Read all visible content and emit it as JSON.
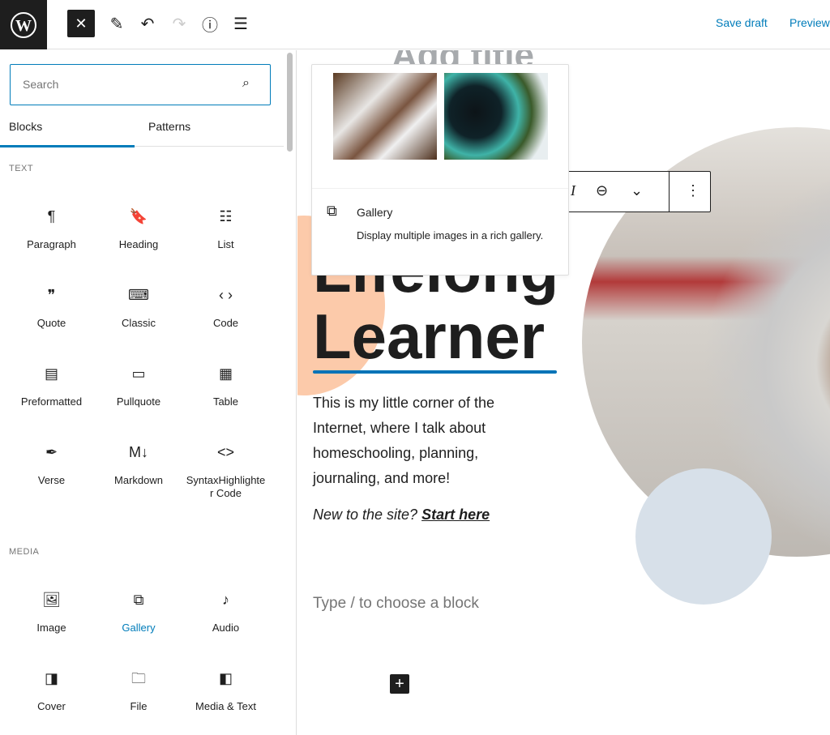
{
  "topbar": {
    "logo": "W",
    "close_glyph": "✕",
    "save_draft": "Save draft",
    "preview": "Preview",
    "tools": [
      {
        "name": "edit-pencil-icon",
        "glyph": "✎"
      },
      {
        "name": "undo-icon",
        "glyph": "↶"
      },
      {
        "name": "redo-icon",
        "glyph": "↷"
      },
      {
        "name": "info-icon",
        "glyph": "ⓘ"
      },
      {
        "name": "list-view-icon",
        "glyph": "☰"
      }
    ]
  },
  "sidebar": {
    "search_placeholder": "Search",
    "tabs": [
      "Blocks",
      "Patterns"
    ],
    "categories": [
      {
        "label": "TEXT",
        "blocks": [
          {
            "label": "Paragraph",
            "icon": "paragraph-icon",
            "glyph": "¶"
          },
          {
            "label": "Heading",
            "icon": "bookmark-icon",
            "glyph": "🔖"
          },
          {
            "label": "List",
            "icon": "list-icon",
            "glyph": "☷"
          },
          {
            "label": "Quote",
            "icon": "quote-icon",
            "glyph": "❞"
          },
          {
            "label": "Classic",
            "icon": "keyboard-icon",
            "glyph": "⌨"
          },
          {
            "label": "Code",
            "icon": "code-icon",
            "glyph": "‹ ›"
          },
          {
            "label": "Preformatted",
            "icon": "preformatted-icon",
            "glyph": "▤"
          },
          {
            "label": "Pullquote",
            "icon": "pullquote-icon",
            "glyph": "▭"
          },
          {
            "label": "Table",
            "icon": "table-icon",
            "glyph": "▦"
          },
          {
            "label": "Verse",
            "icon": "feather-icon",
            "glyph": "✒"
          },
          {
            "label": "Markdown",
            "icon": "markdown-icon",
            "glyph": "M↓"
          },
          {
            "label": "SyntaxHighlighter Code",
            "icon": "code-brackets-icon",
            "glyph": "<>"
          }
        ]
      },
      {
        "label": "MEDIA",
        "blocks": [
          {
            "label": "Image",
            "icon": "image-icon",
            "glyph": "🖼"
          },
          {
            "label": "Gallery",
            "icon": "gallery-icon",
            "glyph": "⧉",
            "active": true
          },
          {
            "label": "Audio",
            "icon": "music-note-icon",
            "glyph": "♪"
          },
          {
            "label": "Cover",
            "icon": "cover-icon",
            "glyph": "◨"
          },
          {
            "label": "File",
            "icon": "folder-icon",
            "glyph": "🗀"
          },
          {
            "label": "Media & Text",
            "icon": "media-text-icon",
            "glyph": "◧"
          }
        ]
      }
    ]
  },
  "popover": {
    "title": "Gallery",
    "description": "Display multiple images in a rich gallery."
  },
  "toolbar": {
    "italic": "I",
    "link": "⊖",
    "more": "⌄",
    "options": "⋮"
  },
  "canvas": {
    "title_placeholder": "Add title",
    "headline_line1": "Lifelong",
    "headline_line2": "Learner",
    "paragraph": "This is my little corner of the Internet, where I talk about homeschooling, planning, journaling, and more!",
    "cta_prefix": "New to the site? ",
    "cta_link": "Start here",
    "block_placeholder": "Type / to choose a block",
    "add_glyph": "+"
  },
  "colors": {
    "accent": "#007cba",
    "peach": "#fccaaa",
    "bluegrey": "#d7e0e9"
  }
}
